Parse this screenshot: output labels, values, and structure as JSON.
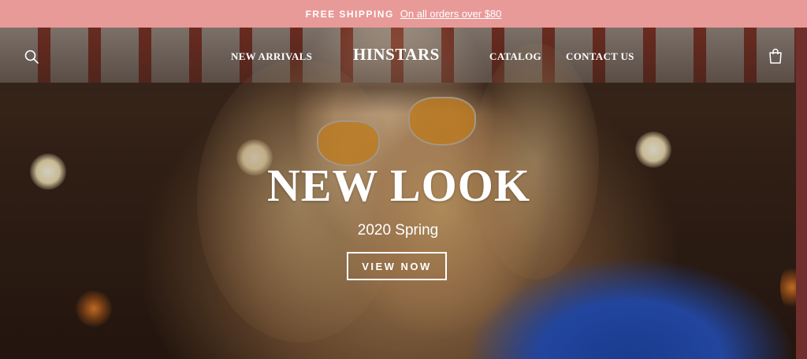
{
  "announcement": {
    "label": "FREE SHIPPING",
    "link_text": "On all orders over $80"
  },
  "header": {
    "logo": "HINSTARS",
    "nav": [
      "NEW ARRIVALS",
      "CATALOG",
      "CONTACT US"
    ],
    "icons": {
      "search": "search-icon",
      "cart": "shopping-bag-icon"
    }
  },
  "hero": {
    "headline": "NEW LOOK",
    "subheadline": "2020 Spring",
    "cta_label": "VIEW NOW",
    "image": "woman-with-orange-sunglasses-photo"
  },
  "colors": {
    "announcement_bg": "#e89a98",
    "text": "#ffffff"
  }
}
